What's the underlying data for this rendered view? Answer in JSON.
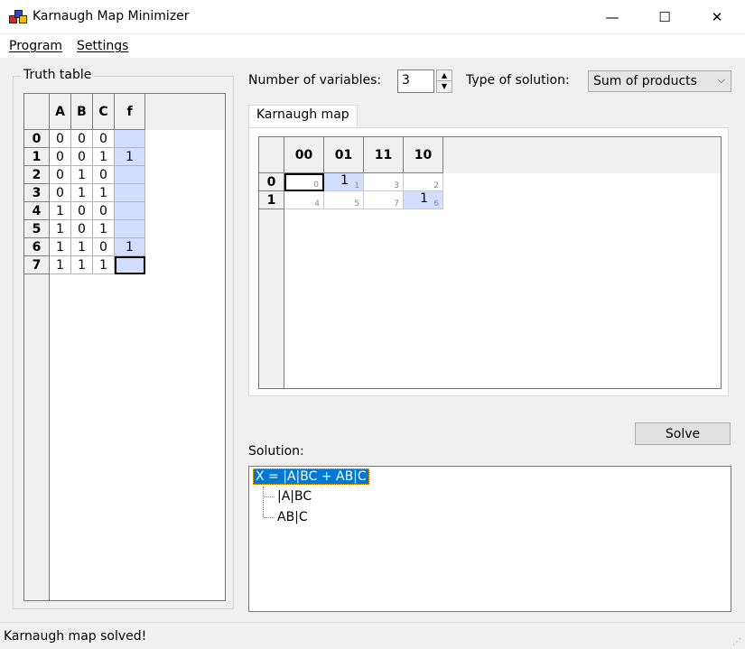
{
  "window": {
    "title": "Karnaugh Map Minimizer",
    "controls": {
      "minimize": "—",
      "maximize": "☐",
      "close": "✕"
    }
  },
  "menu": {
    "program": "Program",
    "settings": "Settings"
  },
  "truth_table": {
    "group_title": "Truth table",
    "headers": [
      "A",
      "B",
      "C",
      "f"
    ],
    "rows": [
      {
        "index": "0",
        "a": "0",
        "b": "0",
        "c": "0",
        "f": ""
      },
      {
        "index": "1",
        "a": "0",
        "b": "0",
        "c": "1",
        "f": "1"
      },
      {
        "index": "2",
        "a": "0",
        "b": "1",
        "c": "0",
        "f": ""
      },
      {
        "index": "3",
        "a": "0",
        "b": "1",
        "c": "1",
        "f": ""
      },
      {
        "index": "4",
        "a": "1",
        "b": "0",
        "c": "0",
        "f": ""
      },
      {
        "index": "5",
        "a": "1",
        "b": "0",
        "c": "1",
        "f": ""
      },
      {
        "index": "6",
        "a": "1",
        "b": "1",
        "c": "0",
        "f": "1"
      },
      {
        "index": "7",
        "a": "1",
        "b": "1",
        "c": "1",
        "f": ""
      }
    ]
  },
  "controls": {
    "num_vars_label": "Number of variables:",
    "num_vars_value": "3",
    "solution_type_label": "Type of solution:",
    "solution_type_value": "Sum of products"
  },
  "kmap": {
    "tab_label": "Karnaugh map",
    "col_headers": [
      "00",
      "01",
      "11",
      "10"
    ],
    "row_headers": [
      "0",
      "1"
    ],
    "cells": [
      [
        {
          "value": "",
          "index": "0"
        },
        {
          "value": "1",
          "index": "1"
        },
        {
          "value": "",
          "index": "3"
        },
        {
          "value": "",
          "index": "2"
        }
      ],
      [
        {
          "value": "",
          "index": "4"
        },
        {
          "value": "",
          "index": "5"
        },
        {
          "value": "",
          "index": "7"
        },
        {
          "value": "1",
          "index": "6"
        }
      ]
    ]
  },
  "solve_button": "Solve",
  "solution": {
    "label": "Solution:",
    "root": "X = |A|BC + AB|C",
    "children": [
      "|A|BC",
      "AB|C"
    ]
  },
  "status": "Karnaugh map solved!"
}
